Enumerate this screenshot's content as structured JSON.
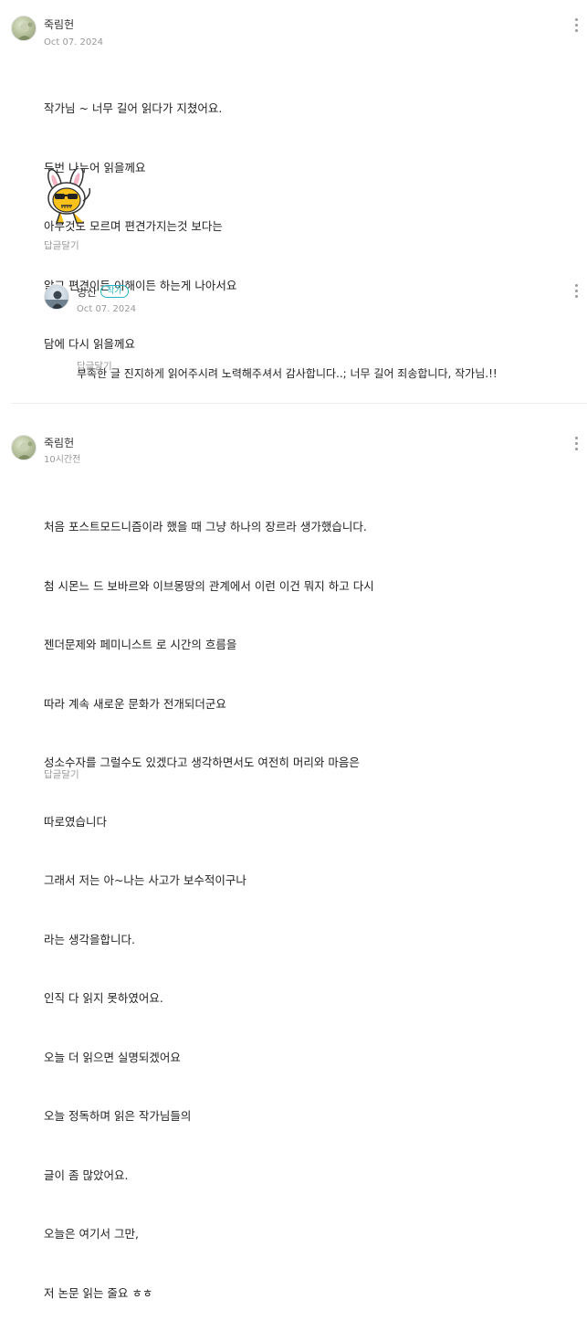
{
  "comments": [
    {
      "nickname": "죽림헌",
      "date": "Oct 07. 2024",
      "lines": [
        "작가님 ~ 너무 길어 읽다가 지쳤어요.",
        "두번 나누어 읽을께요",
        "아무것도 모르며 편견가지는것 보다는",
        "알고 편견이든 이해이든 하는게 나아서요",
        "담에 다시 읽을께요"
      ],
      "sticker": "sunglasses-bunny-sticker",
      "reply_label": "답글달기"
    },
    {
      "nickname": "빙산",
      "badge": "작가",
      "date": "Oct 07. 2024",
      "lines": [
        "부족한 글 진지하게 읽어주시려 노력해주셔서 감사합니다..; 너무 길어 죄송합니다, 작가님.!!"
      ],
      "reply_label": "답글달기"
    },
    {
      "nickname": "죽림헌",
      "date": "10시간전",
      "lines": [
        "처음 포스트모드니즘이라 했을 때 그냥 하나의 장르라 생가했습니다.",
        "첨 시몬느 드 보바르와 이브몽땅의 관계에서 이런 이건 뭐지 하고 다시",
        "젠더문제와 페미니스트 로 시간의 흐름을",
        "따라 계속 새로운 문화가 전개되더군요",
        "성소수자를 그럴수도 있겠다고 생각하면서도 여전히 머리와 마음은",
        "따로였습니다",
        "그래서 저는 아~나는 사고가 보수적이구나",
        "라는 생각을합니다.",
        "인직 다 읽지 못하였어요.",
        "오늘 더 읽으면 실명되겠어요",
        "오늘 정독하며 읽은 작가님들의",
        "글이 좀 많았어요.",
        "오늘은 여기서 그만,",
        "저 논문 읽는 줄요 ㅎㅎ"
      ],
      "reply_label": "답글달기"
    }
  ],
  "colors": {
    "badge": "#26b5c2",
    "meta": "#999999",
    "text": "#222222"
  }
}
